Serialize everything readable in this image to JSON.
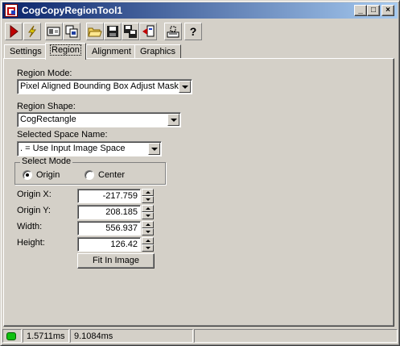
{
  "window": {
    "title": "CogCopyRegionTool1",
    "minimize_glyph": "_",
    "maximize_glyph": "□",
    "close_glyph": "×"
  },
  "toolbar": {
    "buttons": [
      {
        "name": "run-icon"
      },
      {
        "name": "electric-icon"
      },
      {
        "name": "image-source-icon"
      },
      {
        "name": "copy-icon"
      },
      {
        "name": "open-folder-icon"
      },
      {
        "name": "save-icon"
      },
      {
        "name": "save-as-icon"
      },
      {
        "name": "reset-icon"
      },
      {
        "name": "region-edit-icon"
      },
      {
        "name": "help-icon"
      }
    ],
    "help_glyph": "?"
  },
  "tabs": [
    "Settings",
    "Region",
    "Alignment",
    "Graphics"
  ],
  "active_tab": "Region",
  "region": {
    "mode_label": "Region Mode:",
    "mode_value": "Pixel Aligned Bounding Box Adjust Mask",
    "shape_label": "Region Shape:",
    "shape_value": "CogRectangle",
    "space_label": "Selected Space Name:",
    "space_value": ". = Use Input Image Space",
    "select_mode_title": "Select Mode",
    "select_mode_options": [
      "Origin",
      "Center"
    ],
    "select_mode_selected": "Origin",
    "fields": [
      {
        "label": "Origin X:",
        "value": "-217.759"
      },
      {
        "label": "Origin Y:",
        "value": "208.185"
      },
      {
        "label": "Width:",
        "value": "556.937"
      },
      {
        "label": "Height:",
        "value": "126.42"
      }
    ],
    "fit_button": "Fit In Image"
  },
  "status": {
    "led_color": "#10c010",
    "time1": "1.5711ms",
    "time2": "9.1084ms"
  }
}
